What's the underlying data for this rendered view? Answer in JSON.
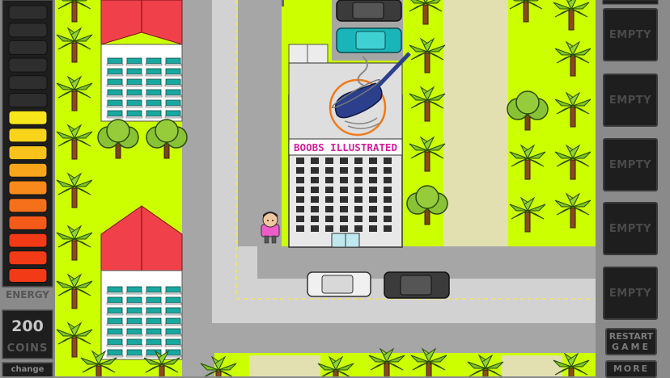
{
  "hud": {
    "energy_label": "ENERGY",
    "energy_level": 0.62,
    "coins_value": "200",
    "coins_label": "COINS",
    "change_label": "change"
  },
  "building": {
    "sign": "BOOBS ILLUSTRATED"
  },
  "inventory": {
    "slots": [
      {
        "label": "EMPTY"
      },
      {
        "label": "EMPTY"
      },
      {
        "label": "EMPTY"
      },
      {
        "label": "EMPTY"
      },
      {
        "label": "EMPTY"
      }
    ]
  },
  "buttons": {
    "restart_line1": "RESTART",
    "restart_line2": "GAME",
    "more_label": "MORE"
  },
  "colors": {
    "grass": "#ccff00",
    "road": "#a6a6a6",
    "sidewalk": "#d2d2d2",
    "roof": "#f0414a",
    "sign_text": "#d61f9a",
    "energy_red": "#f23a16",
    "energy_yellow": "#f7e61a"
  }
}
